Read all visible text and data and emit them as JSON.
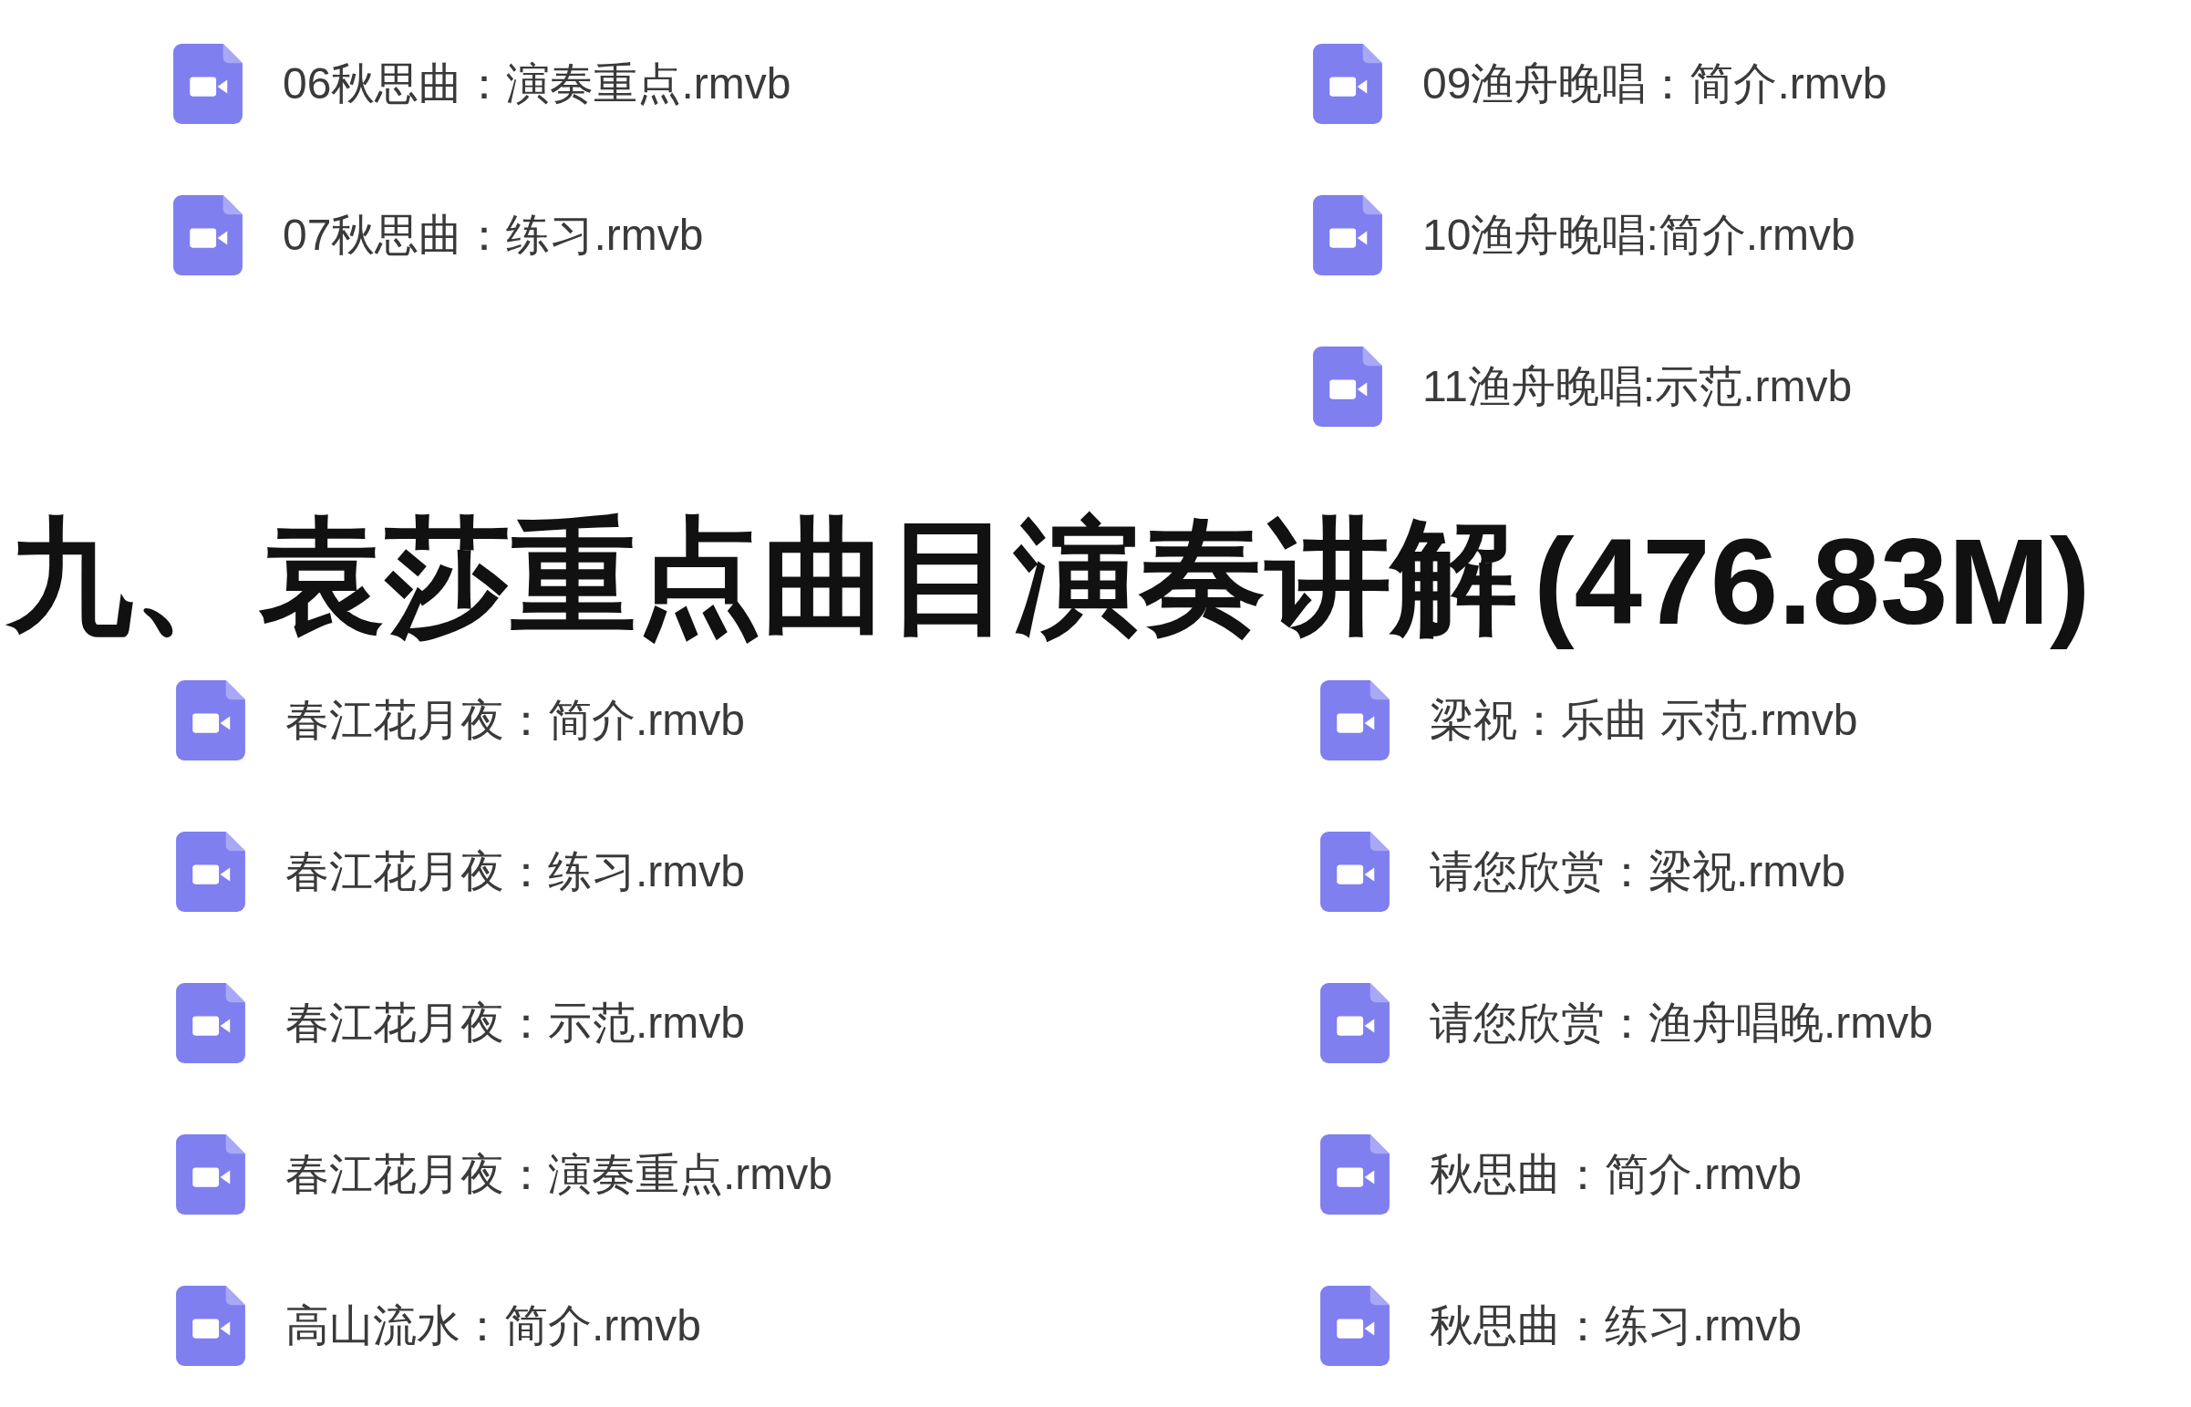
{
  "top_files": {
    "left": [
      {
        "name": "06秋思曲：演奏重点.rmvb"
      },
      {
        "name": "07秋思曲：练习.rmvb"
      }
    ],
    "right": [
      {
        "name": "09渔舟晚唱：简介.rmvb"
      },
      {
        "name": "10渔舟晚唱:简介.rmvb"
      },
      {
        "name": "11渔舟晚唱:示范.rmvb"
      }
    ]
  },
  "section": {
    "title": "九、袁莎重点曲目演奏讲解",
    "size": "(476.83M)"
  },
  "section_files": {
    "left": [
      {
        "name": "春江花月夜：简介.rmvb"
      },
      {
        "name": "春江花月夜：练习.rmvb"
      },
      {
        "name": "春江花月夜：示范.rmvb"
      },
      {
        "name": "春江花月夜：演奏重点.rmvb"
      },
      {
        "name": "高山流水：简介.rmvb"
      }
    ],
    "right": [
      {
        "name": "梁祝：乐曲 示范.rmvb"
      },
      {
        "name": "请您欣赏：梁祝.rmvb"
      },
      {
        "name": "请您欣赏：渔舟唱晚.rmvb"
      },
      {
        "name": "秋思曲：简介.rmvb"
      },
      {
        "name": "秋思曲：练习.rmvb"
      }
    ]
  }
}
